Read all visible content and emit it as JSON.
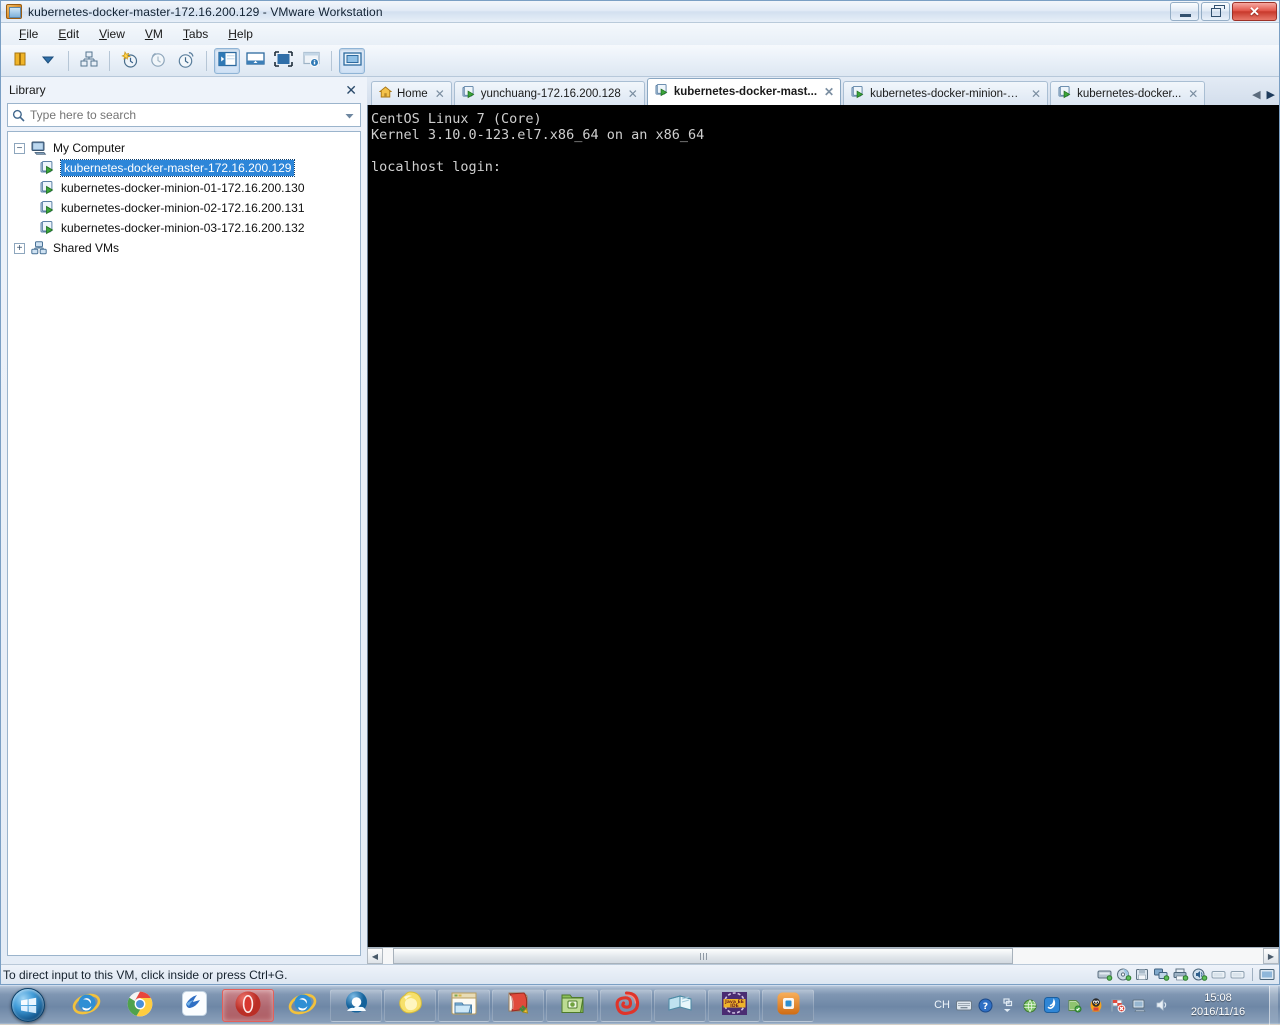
{
  "window": {
    "title": "kubernetes-docker-master-172.16.200.129 - VMware Workstation",
    "title_icon": "vmware-app-icon",
    "minimize_label": "Minimize",
    "restore_label": "Restore",
    "close_label": "✕"
  },
  "menu": {
    "items": [
      {
        "label": "File",
        "accel": "F"
      },
      {
        "label": "Edit",
        "accel": "E"
      },
      {
        "label": "View",
        "accel": "V"
      },
      {
        "label": "VM",
        "accel": "V"
      },
      {
        "label": "Tabs",
        "accel": "T"
      },
      {
        "label": "Help",
        "accel": "H"
      }
    ]
  },
  "toolbar": {
    "buttons": [
      {
        "name": "power-suspend",
        "icon": "suspend-icon"
      },
      {
        "name": "power-dropdown",
        "icon": "chevron-down-icon"
      },
      {
        "name": "manage-snapshots",
        "icon": "snapshot-manager-icon"
      },
      {
        "name": "take-snapshot",
        "icon": "take-snapshot-icon"
      },
      {
        "name": "revert-snapshot",
        "icon": "revert-snapshot-icon"
      },
      {
        "name": "snapshot-manager",
        "icon": "snapshot-clock-icon"
      },
      {
        "name": "show-library",
        "icon": "show-library-icon",
        "pressed": true
      },
      {
        "name": "show-console-view",
        "icon": "console-view-icon"
      },
      {
        "name": "enter-fullscreen",
        "icon": "fullscreen-icon"
      },
      {
        "name": "show-thumbnails",
        "icon": "thumbnail-bar-icon"
      },
      {
        "name": "unity-mode",
        "icon": "unity-mode-icon"
      }
    ]
  },
  "library": {
    "title": "Library",
    "close_label": "✕",
    "search": {
      "placeholder": "Type here to search",
      "value": "",
      "icon": "search-icon",
      "dropdown_icon": "chevron-down-icon"
    },
    "tree": [
      {
        "label": "My Computer",
        "icon": "my-computer-icon",
        "expander": "−",
        "expanded": true,
        "children": [
          {
            "label": "kubernetes-docker-master-172.16.200.129",
            "icon": "vm-powered-on-icon",
            "selected": true
          },
          {
            "label": "kubernetes-docker-minion-01-172.16.200.130",
            "icon": "vm-powered-on-icon",
            "selected": false
          },
          {
            "label": "kubernetes-docker-minion-02-172.16.200.131",
            "icon": "vm-powered-on-icon",
            "selected": false
          },
          {
            "label": "kubernetes-docker-minion-03-172.16.200.132",
            "icon": "vm-powered-on-icon",
            "selected": false
          }
        ]
      },
      {
        "label": "Shared VMs",
        "icon": "shared-vms-icon",
        "expander": "+",
        "expanded": false,
        "children": []
      }
    ]
  },
  "tabs": {
    "items": [
      {
        "label": "Home",
        "icon": "home-icon",
        "active": false,
        "close_label": "✕"
      },
      {
        "label": "yunchuang-172.16.200.128",
        "icon": "vm-powered-on-icon",
        "active": false,
        "close_label": "✕"
      },
      {
        "label": "kubernetes-docker-mast...",
        "icon": "vm-powered-on-icon",
        "active": true,
        "close_label": "✕"
      },
      {
        "label": "kubernetes-docker-minion-01-...",
        "icon": "vm-powered-on-icon",
        "active": false,
        "close_label": "✕"
      },
      {
        "label": "kubernetes-docker...",
        "icon": "vm-powered-on-icon",
        "active": false,
        "close_label": "✕"
      }
    ],
    "nav_prev": "◀",
    "nav_next": "▶"
  },
  "console": {
    "lines": [
      "CentOS Linux 7 (Core)",
      "Kernel 3.10.0-123.el7.x86_64 on an x86_64",
      "",
      "localhost login:"
    ],
    "text_color": "#cfcfcf",
    "background": "#000000"
  },
  "scrollbar": {
    "left_arrow": "◀",
    "right_arrow": "▶",
    "thumb_grip": "|||"
  },
  "status_bar": {
    "message": "To direct input to this VM, click inside or press Ctrl+G.",
    "devices": [
      {
        "name": "hard-disk-icon"
      },
      {
        "name": "cd-dvd-icon"
      },
      {
        "name": "floppy-icon"
      },
      {
        "name": "network-adapter-icon"
      },
      {
        "name": "usb-printer-icon"
      },
      {
        "name": "sound-card-icon"
      },
      {
        "name": "usb-device-1-icon"
      },
      {
        "name": "usb-device-2-icon"
      },
      {
        "name": "display-icon"
      }
    ]
  },
  "taskbar": {
    "start_label": "Start",
    "items": [
      {
        "name": "internet-explorer",
        "icon": "ie-icon",
        "active": false,
        "pinned": true
      },
      {
        "name": "google-chrome",
        "icon": "chrome-icon",
        "active": false,
        "pinned": true
      },
      {
        "name": "foxmail",
        "icon": "bird-icon",
        "active": false,
        "pinned": true
      },
      {
        "name": "opera-browser",
        "icon": "opera-icon",
        "active": true,
        "pinned": false
      },
      {
        "name": "internet-explorer-2",
        "icon": "ie-icon",
        "active": false,
        "pinned": true
      },
      {
        "name": "cloud-app",
        "icon": "cloud-blue-icon",
        "active": false,
        "pinned": false
      },
      {
        "name": "yellow-app",
        "icon": "yellow-blob-icon",
        "active": false,
        "pinned": false
      },
      {
        "name": "file-explorer",
        "icon": "folder-window-icon",
        "active": false,
        "pinned": false
      },
      {
        "name": "notepad-plus",
        "icon": "red-notepad-icon",
        "active": false,
        "pinned": false
      },
      {
        "name": "green-folder-app",
        "icon": "green-folder-icon",
        "active": false,
        "pinned": false
      },
      {
        "name": "red-spiral-app",
        "icon": "red-spiral-icon",
        "active": false,
        "pinned": false
      },
      {
        "name": "book-app",
        "icon": "open-book-icon",
        "active": false,
        "pinned": false
      },
      {
        "name": "eclipse-java-ee-ide",
        "icon": "java-ee-ide-icon",
        "active": false,
        "pinned": false
      },
      {
        "name": "vmware-workstation",
        "icon": "vmware-icon",
        "active": false,
        "pinned": false
      }
    ],
    "tray": {
      "language": "CH",
      "icons": [
        {
          "name": "keyboard-icon"
        },
        {
          "name": "help-question-icon"
        },
        {
          "name": "show-hidden-icons-icon"
        },
        {
          "name": "globe-icon"
        },
        {
          "name": "sogou-input-icon"
        },
        {
          "name": "green-shield-icon"
        },
        {
          "name": "qq-penguin-icon"
        },
        {
          "name": "flag-action-center-icon"
        },
        {
          "name": "network-icon"
        },
        {
          "name": "volume-icon"
        }
      ],
      "time": "15:08",
      "date": "2016/11/16"
    },
    "show_desktop_label": "Show desktop"
  },
  "colors": {
    "accent_blue": "#2d86d9",
    "title_bar": "#e2ebf6",
    "console_bg": "#000000",
    "close_red": "#c8392c",
    "vm_green": "#3ba53b"
  }
}
